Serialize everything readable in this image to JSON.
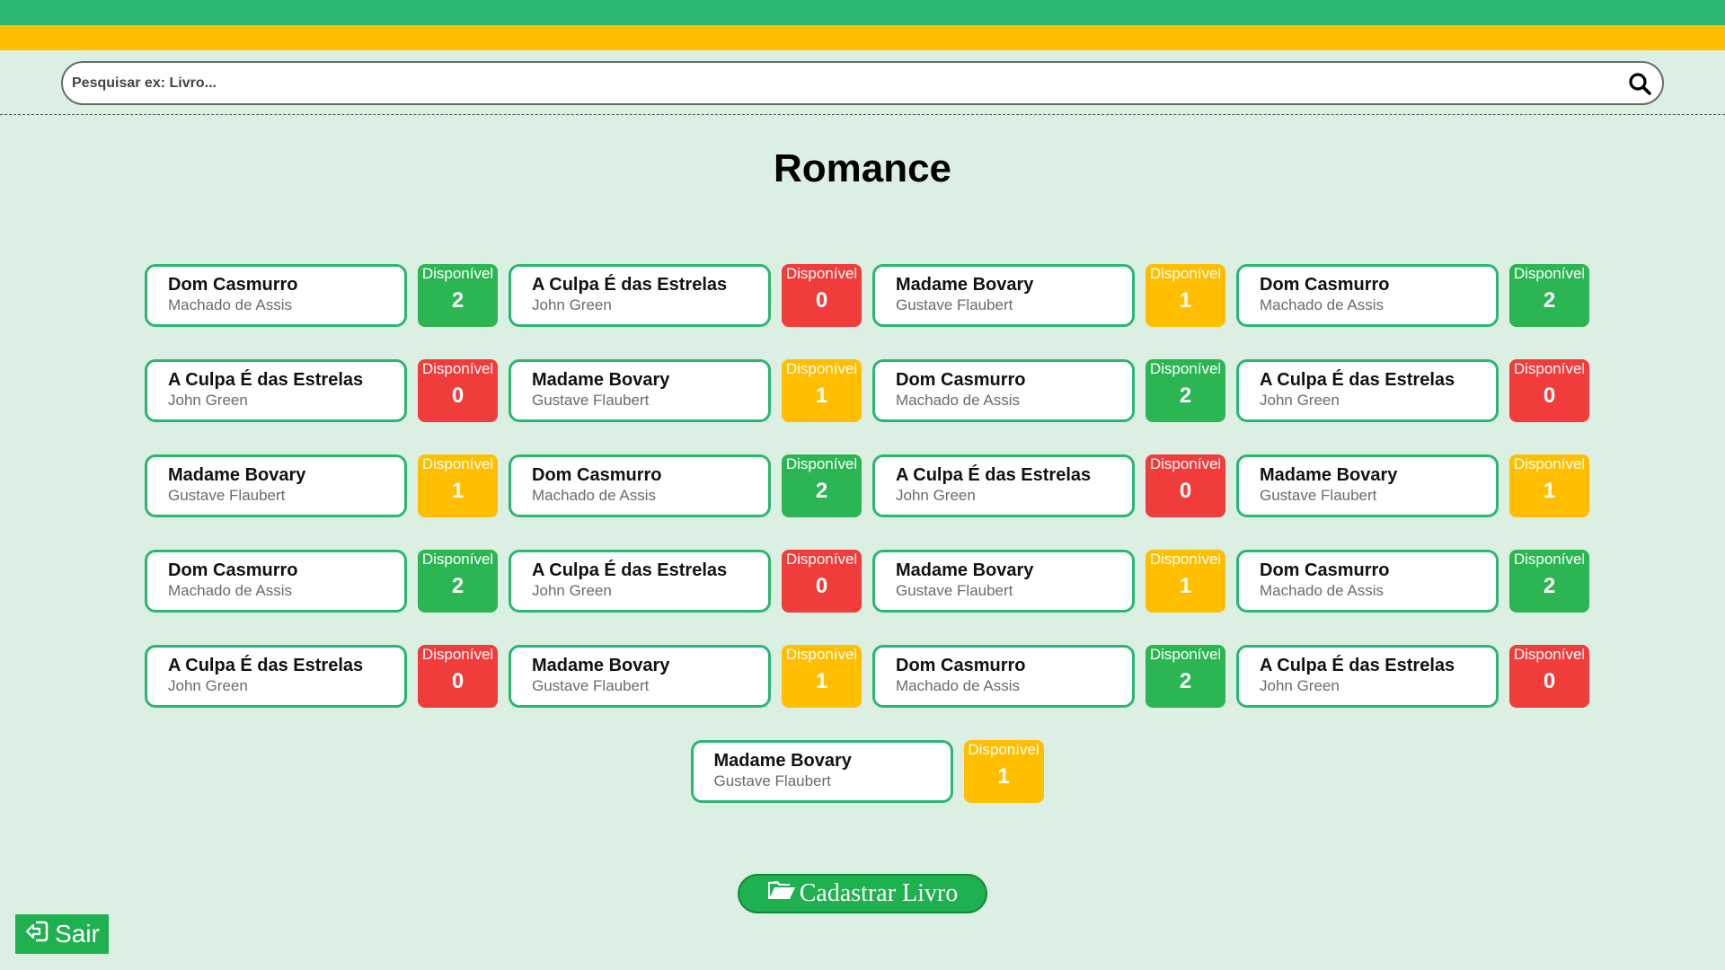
{
  "header": {
    "green_color": "#2bb673",
    "yellow_color": "#ffbe00"
  },
  "search": {
    "placeholder": "Pesquisar ex: Livro...",
    "value": "",
    "icon": "search-icon"
  },
  "page": {
    "title": "Romance"
  },
  "books": [
    {
      "title": "Dom Casmurro",
      "author": "Machado de Assis",
      "label": "Disponível",
      "count": "2",
      "status": "green"
    },
    {
      "title": "A Culpa É das Estrelas",
      "author": "John Green",
      "label": "Disponível",
      "count": "0",
      "status": "red"
    },
    {
      "title": "Madame Bovary",
      "author": "Gustave Flaubert",
      "label": "Disponível",
      "count": "1",
      "status": "yellow"
    },
    {
      "title": "Dom Casmurro",
      "author": "Machado de Assis",
      "label": "Disponível",
      "count": "2",
      "status": "green"
    },
    {
      "title": "A Culpa É das Estrelas",
      "author": "John Green",
      "label": "Disponível",
      "count": "0",
      "status": "red"
    },
    {
      "title": "Madame Bovary",
      "author": "Gustave Flaubert",
      "label": "Disponível",
      "count": "1",
      "status": "yellow"
    },
    {
      "title": "Dom Casmurro",
      "author": "Machado de Assis",
      "label": "Disponível",
      "count": "2",
      "status": "green"
    },
    {
      "title": "A Culpa É das Estrelas",
      "author": "John Green",
      "label": "Disponível",
      "count": "0",
      "status": "red"
    },
    {
      "title": "Madame Bovary",
      "author": "Gustave Flaubert",
      "label": "Disponível",
      "count": "1",
      "status": "yellow"
    },
    {
      "title": "Dom Casmurro",
      "author": "Machado de Assis",
      "label": "Disponível",
      "count": "2",
      "status": "green"
    },
    {
      "title": "A Culpa É das Estrelas",
      "author": "John Green",
      "label": "Disponível",
      "count": "0",
      "status": "red"
    },
    {
      "title": "Madame Bovary",
      "author": "Gustave Flaubert",
      "label": "Disponível",
      "count": "1",
      "status": "yellow"
    },
    {
      "title": "Dom Casmurro",
      "author": "Machado de Assis",
      "label": "Disponível",
      "count": "2",
      "status": "green"
    },
    {
      "title": "A Culpa É das Estrelas",
      "author": "John Green",
      "label": "Disponível",
      "count": "0",
      "status": "red"
    },
    {
      "title": "Madame Bovary",
      "author": "Gustave Flaubert",
      "label": "Disponível",
      "count": "1",
      "status": "yellow"
    },
    {
      "title": "Dom Casmurro",
      "author": "Machado de Assis",
      "label": "Disponível",
      "count": "2",
      "status": "green"
    },
    {
      "title": "A Culpa É das Estrelas",
      "author": "John Green",
      "label": "Disponível",
      "count": "0",
      "status": "red"
    },
    {
      "title": "Madame Bovary",
      "author": "Gustave Flaubert",
      "label": "Disponível",
      "count": "1",
      "status": "yellow"
    },
    {
      "title": "Dom Casmurro",
      "author": "Machado de Assis",
      "label": "Disponível",
      "count": "2",
      "status": "green"
    },
    {
      "title": "A Culpa É das Estrelas",
      "author": "John Green",
      "label": "Disponível",
      "count": "0",
      "status": "red"
    },
    {
      "title": "Madame Bovary",
      "author": "Gustave Flaubert",
      "label": "Disponível",
      "count": "1",
      "status": "yellow"
    }
  ],
  "status_colors": {
    "green": "#2bb653",
    "red": "#f13c3c",
    "yellow": "#ffbe00"
  },
  "actions": {
    "cadastrar_label": "Cadastrar Livro",
    "cadastrar_icon": "folder-open-icon",
    "sair_label": "Sair",
    "sair_icon": "sign-out-icon"
  }
}
